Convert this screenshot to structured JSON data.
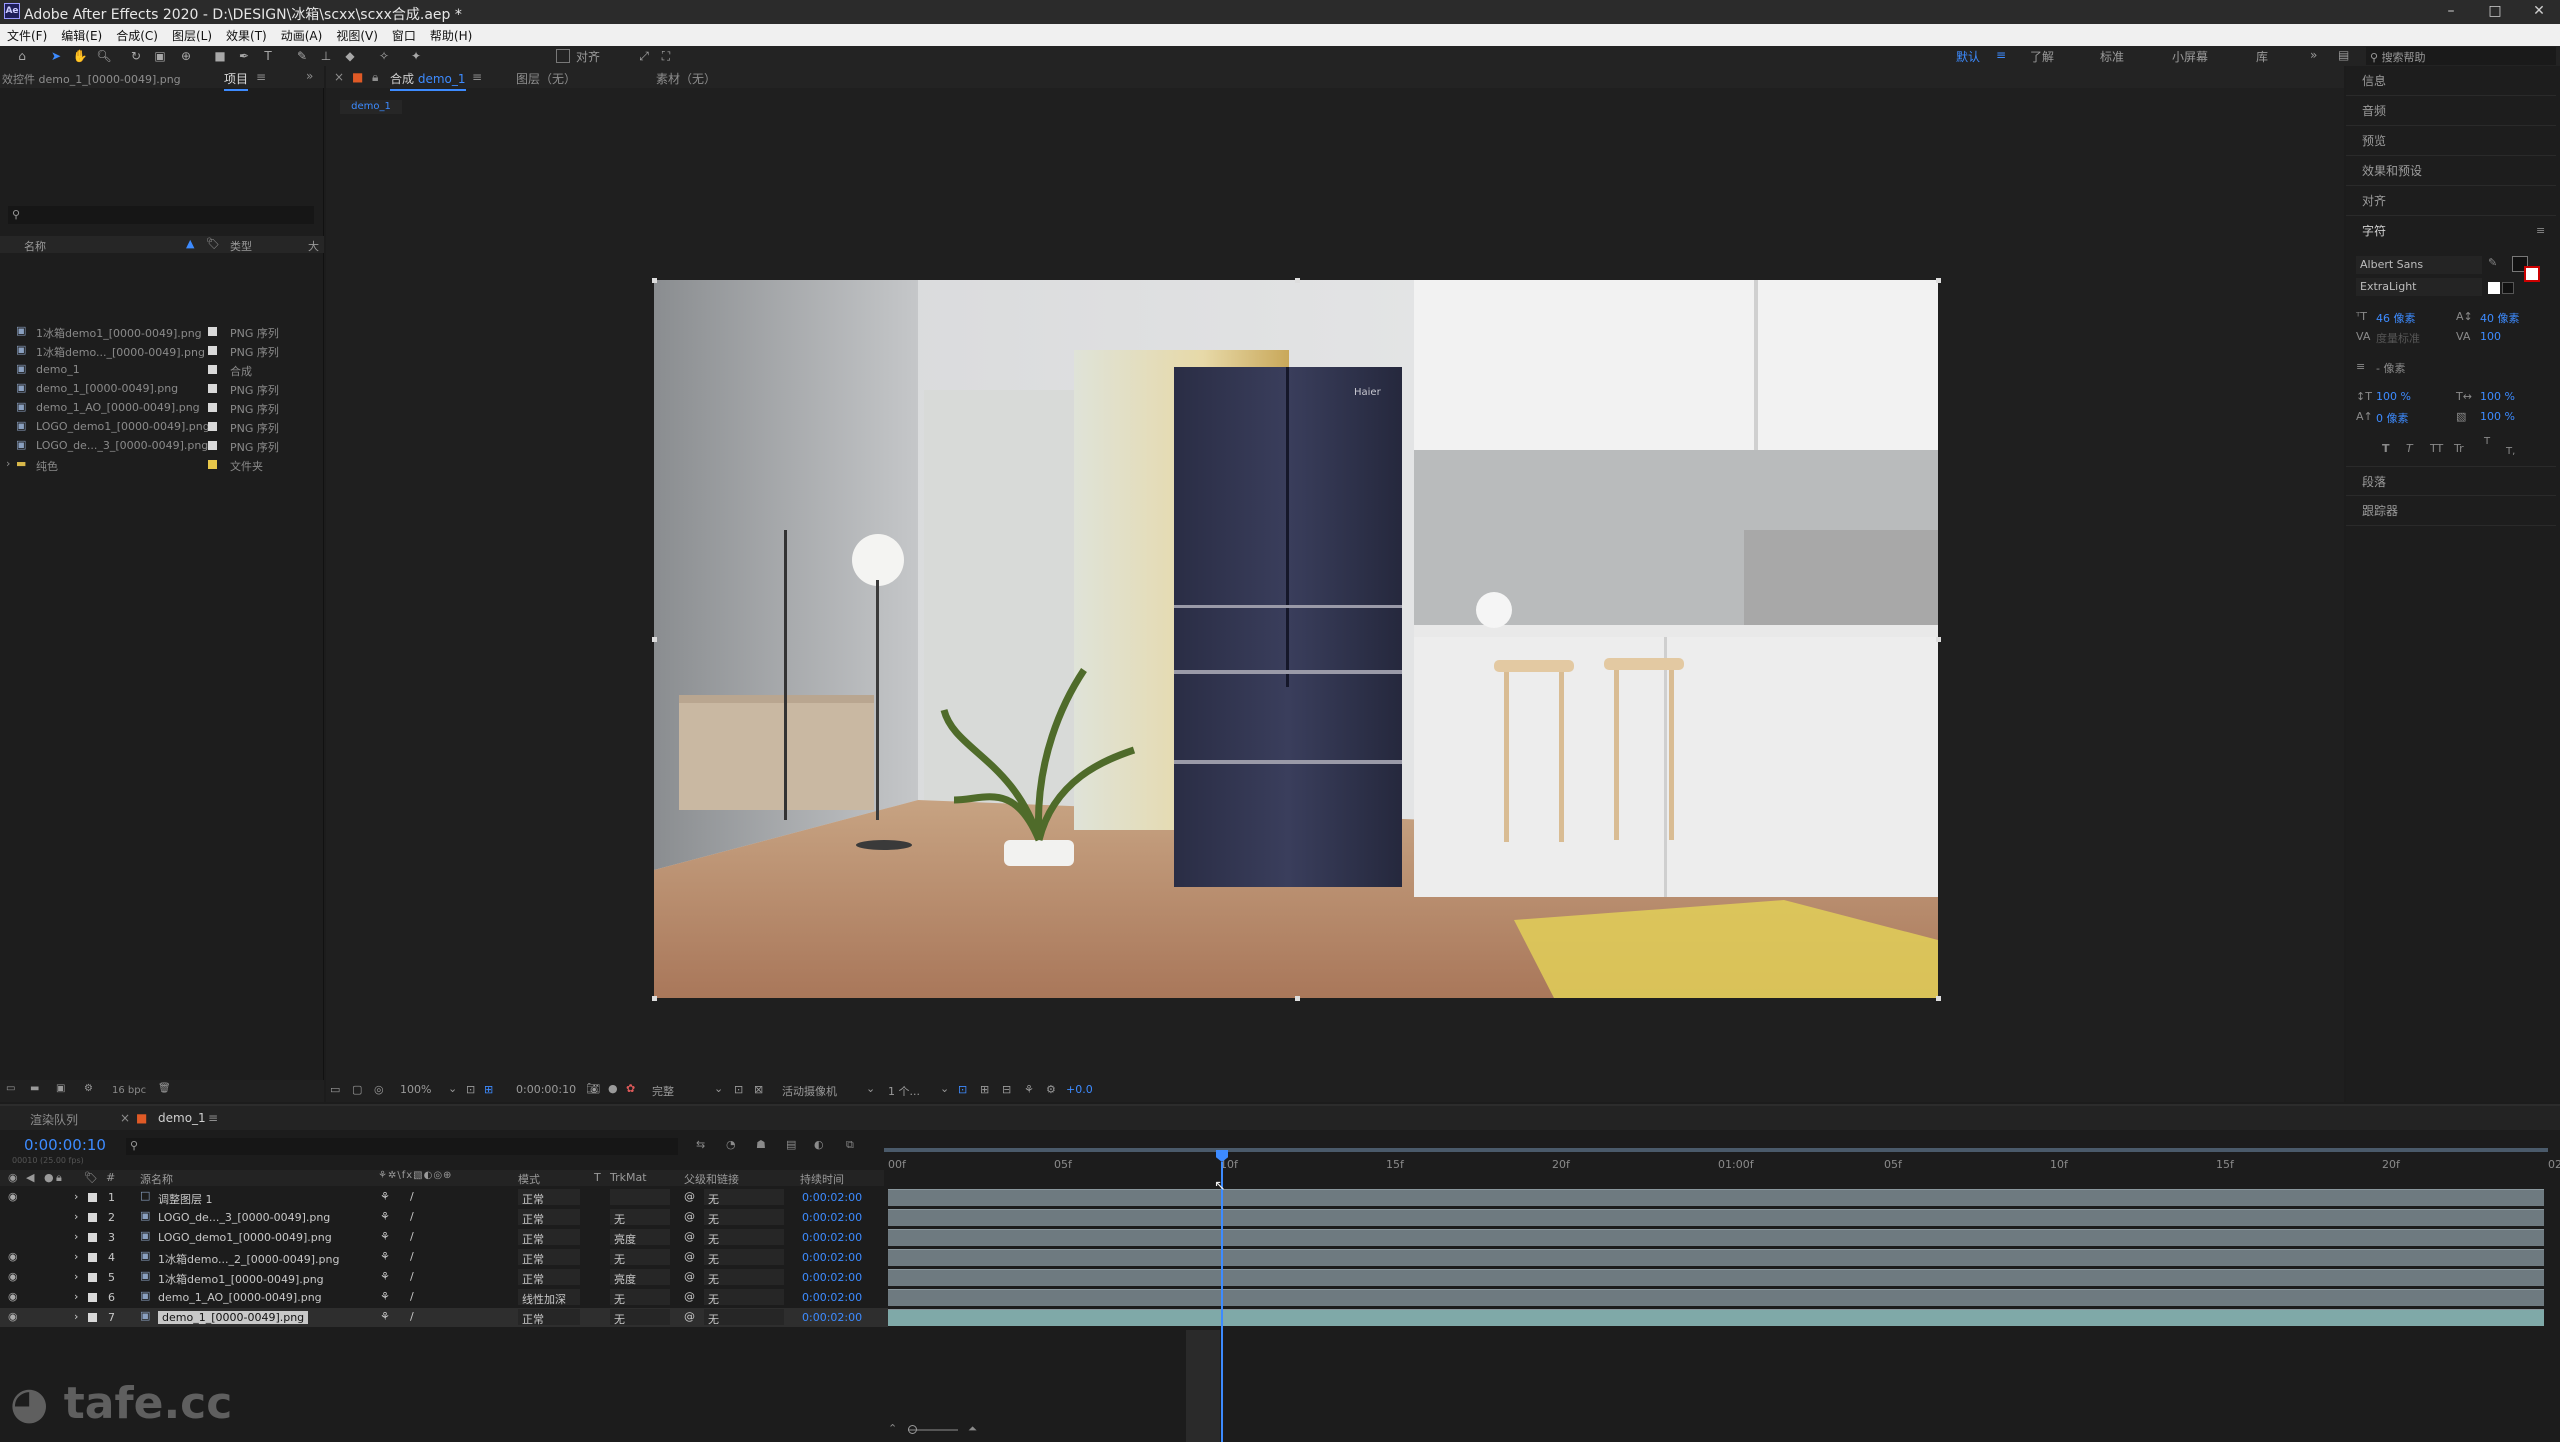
{
  "window": {
    "title": "Adobe After Effects 2020 - D:\\DESIGN\\冰箱\\scxx\\scxx合成.aep *",
    "logo": "Ae"
  },
  "menu": [
    "文件(F)",
    "编辑(E)",
    "合成(C)",
    "图层(L)",
    "效果(T)",
    "动画(A)",
    "视图(V)",
    "窗口",
    "帮助(H)"
  ],
  "toolbar": {
    "align_label": "对齐",
    "workspaces": [
      "默认",
      "了解",
      "标准",
      "小屏幕",
      "库"
    ],
    "active_workspace": "默认",
    "search_placeholder": "搜索帮助"
  },
  "project": {
    "top_label": "效控件 demo_1_[0000-0049].png",
    "tab": "项目",
    "search_placeholder": "",
    "columns": [
      "名称",
      "类型",
      "大"
    ],
    "items": [
      {
        "name": "1冰箱demo1_[0000-0049].png",
        "type": "PNG 序列",
        "color": "#d9d9d9"
      },
      {
        "name": "1冰箱demo..._[0000-0049].png",
        "type": "PNG 序列",
        "color": "#d9d9d9"
      },
      {
        "name": "demo_1",
        "type": "合成",
        "color": "#d9d9d9"
      },
      {
        "name": "demo_1_[0000-0049].png",
        "type": "PNG 序列",
        "color": "#d9d9d9"
      },
      {
        "name": "demo_1_AO_[0000-0049].png",
        "type": "PNG 序列",
        "color": "#d9d9d9"
      },
      {
        "name": "LOGO_demo1_[0000-0049].png",
        "type": "PNG 序列",
        "color": "#d9d9d9"
      },
      {
        "name": "LOGO_de..._3_[0000-0049].png",
        "type": "PNG 序列",
        "color": "#d9d9d9"
      },
      {
        "name": "纯色",
        "type": "文件夹",
        "color": "#e8c84a"
      }
    ],
    "bpc": "16 bpc"
  },
  "viewer": {
    "tabs": [
      "合成 demo_1",
      "图层（无）",
      "素材（无）"
    ],
    "comp_prefix": "合成",
    "comp_name": "demo_1",
    "sub_tab": "demo_1",
    "zoom": "100%",
    "timecode": "0:00:00:10",
    "quality": "完整",
    "camera": "活动摄像机",
    "views": "1 个...",
    "exposure": "+0.0",
    "fridge_brand": "Haier"
  },
  "right_panel": {
    "sections": [
      "信息",
      "音频",
      "预览",
      "效果和预设",
      "对齐"
    ],
    "char_title": "字符",
    "font": "Albert Sans",
    "style": "ExtraLight",
    "size": "46 像素",
    "leading": "40 像素",
    "kerning": "度量标准",
    "tracking": "100",
    "stroke": "- 像素",
    "vscale": "100 %",
    "hscale": "100 %",
    "baseline": "0 像素",
    "tsume": "100 %",
    "formats": [
      "T",
      "T",
      "TT",
      "Tr",
      "T",
      "T,"
    ],
    "bottom": [
      "段落",
      "跟踪器"
    ]
  },
  "timeline": {
    "tabs": [
      "渲染队列",
      "demo_1"
    ],
    "timecode": "0:00:00:10",
    "sub_timecode": "00010 (25.00 fps)",
    "columns": [
      "源名称",
      "模式",
      "T",
      "TrkMat",
      "父级和链接",
      "持续时间"
    ],
    "ruler": [
      "00f",
      "05f",
      "10f",
      "15f",
      "20f",
      "01:00f",
      "05f",
      "10f",
      "15f",
      "20f",
      "02:0"
    ],
    "current_frame": 10,
    "layers": [
      {
        "num": "1",
        "name": "调整图层 1",
        "mode": "正常",
        "trk": "",
        "parent": "无",
        "dur": "0:00:02:00",
        "color": "#d9d9d9",
        "sel": false
      },
      {
        "num": "2",
        "name": "LOGO_de..._3_[0000-0049].png",
        "mode": "正常",
        "trk": "无",
        "parent": "无",
        "dur": "0:00:02:00",
        "color": "#d9d9d9",
        "sel": false
      },
      {
        "num": "3",
        "name": "LOGO_demo1_[0000-0049].png",
        "mode": "正常",
        "trk": "亮度",
        "parent": "无",
        "dur": "0:00:02:00",
        "color": "#d9d9d9",
        "sel": false
      },
      {
        "num": "4",
        "name": "1冰箱demo..._2_[0000-0049].png",
        "mode": "正常",
        "trk": "无",
        "parent": "无",
        "dur": "0:00:02:00",
        "color": "#d9d9d9",
        "sel": false
      },
      {
        "num": "5",
        "name": "1冰箱demo1_[0000-0049].png",
        "mode": "正常",
        "trk": "亮度",
        "parent": "无",
        "dur": "0:00:02:00",
        "color": "#d9d9d9",
        "sel": false
      },
      {
        "num": "6",
        "name": "demo_1_AO_[0000-0049].png",
        "mode": "线性加深",
        "trk": "无",
        "parent": "无",
        "dur": "0:00:02:00",
        "color": "#d9d9d9",
        "sel": false
      },
      {
        "num": "7",
        "name": "demo_1_[0000-0049].png",
        "mode": "正常",
        "trk": "无",
        "parent": "无",
        "dur": "0:00:02:00",
        "color": "#d9d9d9",
        "sel": true
      }
    ]
  },
  "watermark": "tafe.cc",
  "colors": {
    "accent": "#3d8bff",
    "bar": "#6e7a80",
    "selected_bar": "#7fa9a8"
  }
}
